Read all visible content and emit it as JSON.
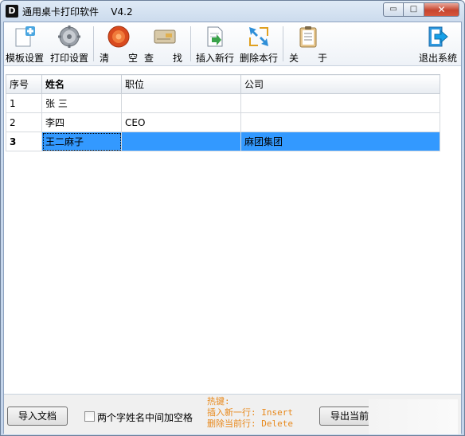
{
  "window": {
    "logo_letter": "D",
    "title": "通用桌卡打印软件",
    "version": "V4.2",
    "minimize_glyph": "▭",
    "maximize_glyph": "□",
    "close_glyph": "✕"
  },
  "toolbar": {
    "template_settings": "模板设置",
    "print_settings": "打印设置",
    "clear": "清　　空",
    "search": "查　　找",
    "insert_row": "插入新行",
    "delete_row": "删除本行",
    "about": "关　　于",
    "exit": "退出系统"
  },
  "grid": {
    "headers": [
      "序号",
      "姓名",
      "职位",
      "公司"
    ],
    "rows": [
      {
        "num": "1",
        "name": "张  三",
        "position": "",
        "company": ""
      },
      {
        "num": "2",
        "name": "李四",
        "position": "CEO",
        "company": ""
      },
      {
        "num": "3",
        "name": "王二麻子",
        "position": "",
        "company": "麻团集团"
      }
    ]
  },
  "bottom": {
    "import_button": "导入文档",
    "checkbox_label": "两个字姓名中间加空格",
    "hotkey_title": "热键:",
    "hotkey_insert": "插入新一行: Insert",
    "hotkey_delete": "删除当前行: Delete",
    "export_button": "导出当前"
  }
}
